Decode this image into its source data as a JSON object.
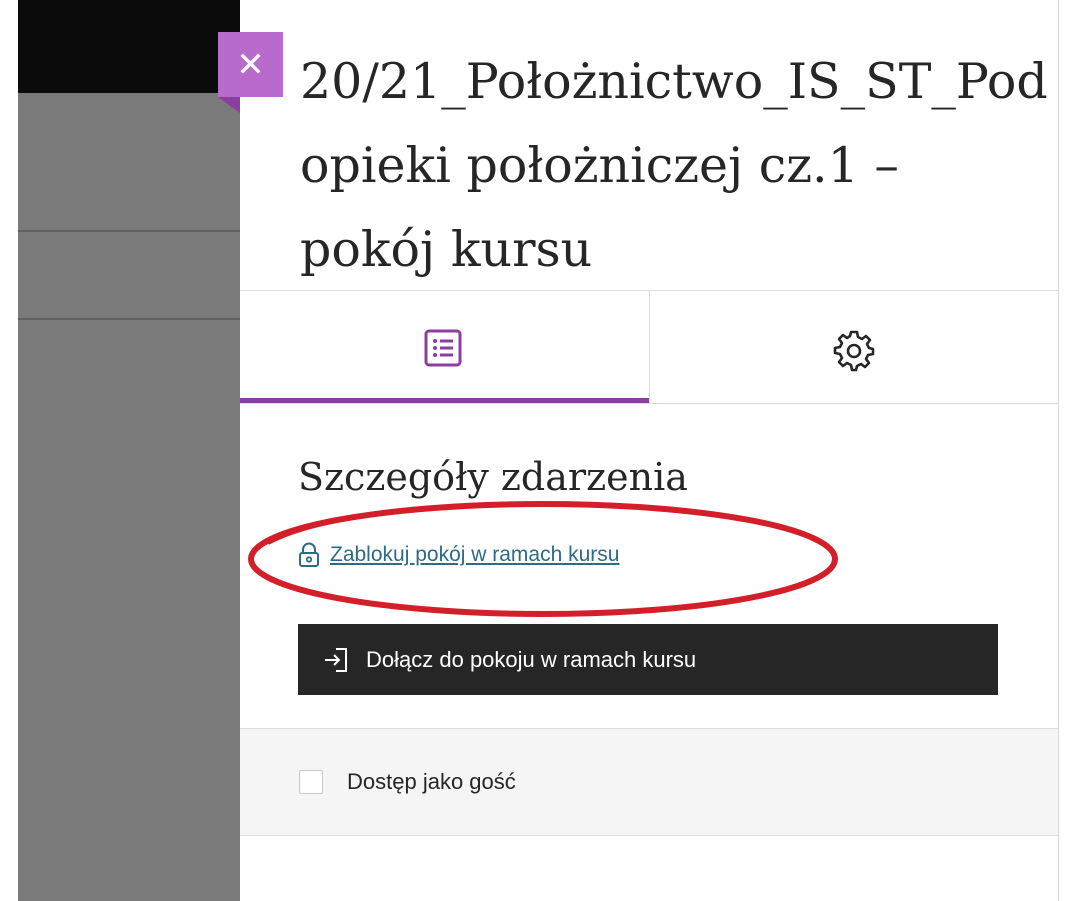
{
  "close_button": {
    "icon": "close-icon"
  },
  "title": {
    "line1": "20/21_Położnictwo_IS_ST_Pod",
    "line2": "opieki położniczej cz.1 –",
    "line3": "pokój kursu"
  },
  "tabs": [
    {
      "icon": "details-list-icon",
      "active": true
    },
    {
      "icon": "gear-icon",
      "active": false
    }
  ],
  "section": {
    "heading": "Szczegóły zdarzenia",
    "lock_link": "Zablokuj pokój w ramach kursu",
    "lock_icon": "lock-icon",
    "join_button": "Dołącz do pokoju w ramach kursu",
    "join_icon": "enter-icon"
  },
  "guest_access": {
    "label": "Dostęp jako gość",
    "checked": false
  },
  "colors": {
    "accent_purple": "#8a3fa0",
    "close_button_bg": "#b96bcd",
    "join_button_bg": "#262626",
    "link": "#2d6b86",
    "annotation_red": "#d21f2a",
    "backdrop": "#7a7a7a"
  }
}
